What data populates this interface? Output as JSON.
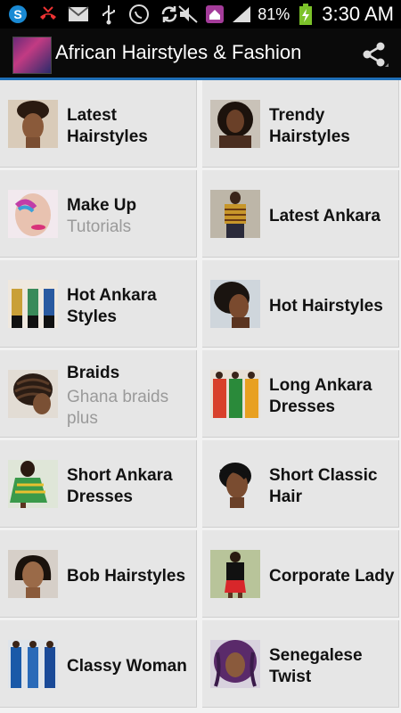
{
  "statusbar": {
    "battery": "81%",
    "time": "3:30 AM",
    "icons": [
      "skype-icon",
      "missed-call-icon",
      "mail-icon",
      "usb-icon",
      "whatsapp-icon",
      "sync-icon",
      "mute-icon",
      "home-notification-icon",
      "signal-icon",
      "battery-charging-icon"
    ]
  },
  "app": {
    "title": "African Hairstyles & Fashion"
  },
  "colors": {
    "accent": "#1f6fb7",
    "tile_bg": "#e6e6e6",
    "subtitle": "#9a9a9a"
  },
  "tiles": [
    {
      "line1": "Latest",
      "line2": "Hairstyles",
      "sub1": "",
      "sub2": ""
    },
    {
      "line1": "Trendy",
      "line2": "Hairstyles",
      "sub1": "",
      "sub2": ""
    },
    {
      "line1": "Make Up",
      "line2": "",
      "sub1": "Tutorials",
      "sub2": ""
    },
    {
      "line1": "Latest Ankara",
      "line2": "",
      "sub1": "",
      "sub2": ""
    },
    {
      "line1": "Hot Ankara",
      "line2": "Styles",
      "sub1": "",
      "sub2": ""
    },
    {
      "line1": "Hot Hairstyles",
      "line2": "",
      "sub1": "",
      "sub2": ""
    },
    {
      "line1": "Braids",
      "line2": "",
      "sub1": "Ghana braids",
      "sub2": "plus"
    },
    {
      "line1": "Long Ankara",
      "line2": "Dresses",
      "sub1": "",
      "sub2": ""
    },
    {
      "line1": "Short Ankara",
      "line2": "Dresses",
      "sub1": "",
      "sub2": ""
    },
    {
      "line1": "Short Classic",
      "line2": "Hair",
      "sub1": "",
      "sub2": ""
    },
    {
      "line1": "Bob Hairstyles",
      "line2": "",
      "sub1": "",
      "sub2": ""
    },
    {
      "line1": "Corporate Lady",
      "line2": "",
      "sub1": "",
      "sub2": ""
    },
    {
      "line1": "Classy Woman",
      "line2": "",
      "sub1": "",
      "sub2": ""
    },
    {
      "line1": "Senegalese",
      "line2": "Twist",
      "sub1": "",
      "sub2": ""
    }
  ]
}
